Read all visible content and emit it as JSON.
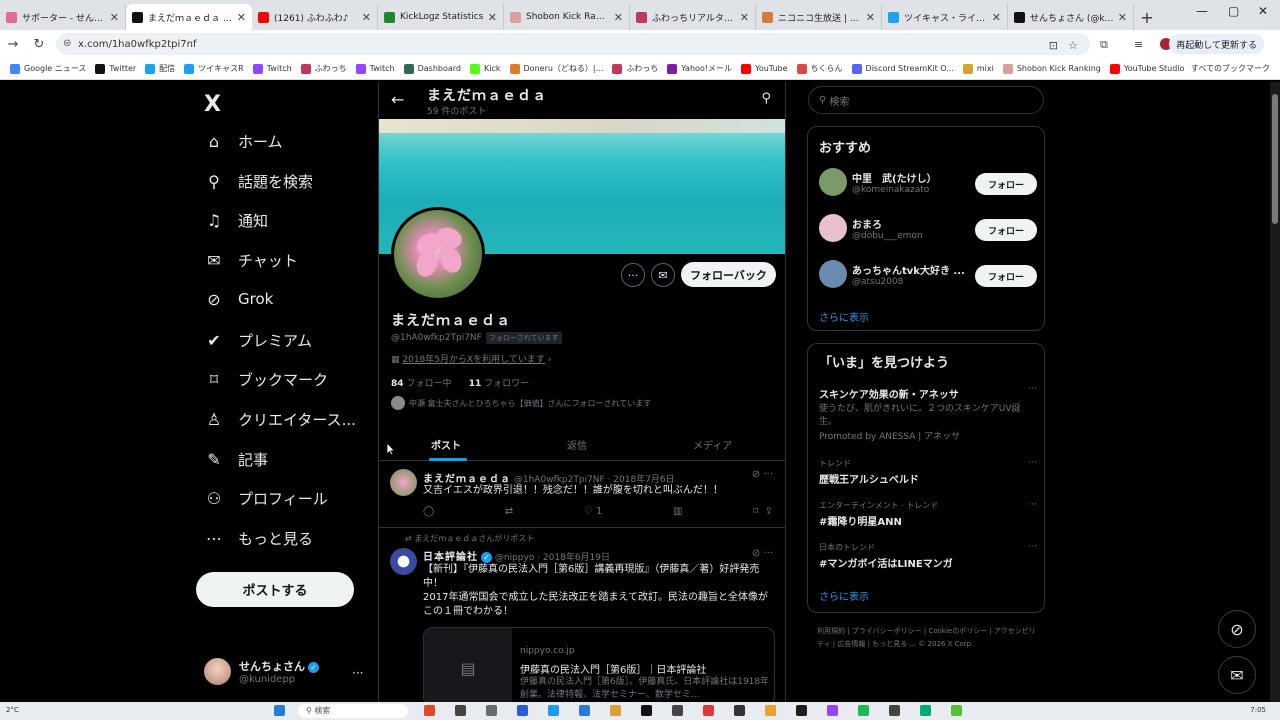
{
  "browser": {
    "tabs": [
      {
        "title": "サポーター - せんちょさん",
        "color": "#e66a8f",
        "active": false
      },
      {
        "title": "まえだｍａｅｄａ (@",
        "color": "#111111",
        "active": true
      },
      {
        "title": "(1261) ふわふわ♪",
        "color": "#ff0000",
        "active": false
      },
      {
        "title": "KickLogz Statistics",
        "color": "#1f8a2b",
        "active": false
      },
      {
        "title": "Shobon Kick Ranking",
        "color": "#d9a0a0",
        "active": false
      },
      {
        "title": "ふわっちリアルタイムランキ",
        "color": "#c0395a",
        "active": false
      },
      {
        "title": "ニコニコ生放送 | リアル",
        "color": "#d97a3a",
        "active": false
      },
      {
        "title": "ツイキャス・ライブでつな",
        "color": "#1da1f2",
        "active": false
      },
      {
        "title": "せんちょさん (@kunid",
        "color": "#111111",
        "active": false
      }
    ],
    "url": "x.com/1ha0wfkp2tpi7nf",
    "restart_label": "再起動して更新する",
    "bookmarks": [
      {
        "label": "Google ニュース",
        "color": "#4285f4"
      },
      {
        "label": "Twitter",
        "color": "#111111"
      },
      {
        "label": "配信",
        "color": "#1da1f2"
      },
      {
        "label": "ツイキャスR",
        "color": "#1da1f2"
      },
      {
        "label": "Twitch",
        "color": "#9146ff"
      },
      {
        "label": "ふわっち",
        "color": "#c0395a"
      },
      {
        "label": "Twitch",
        "color": "#9146ff"
      },
      {
        "label": "Dashboard",
        "color": "#2d6a4f"
      },
      {
        "label": "Kick",
        "color": "#53fc18"
      },
      {
        "label": "Doneru（どねる）|...",
        "color": "#e07a2c"
      },
      {
        "label": "ふわっち",
        "color": "#c0395a"
      },
      {
        "label": "Yahoo!メール",
        "color": "#7b1fa2"
      },
      {
        "label": "YouTube",
        "color": "#ff0000"
      },
      {
        "label": "ちくらん",
        "color": "#d94a4a"
      },
      {
        "label": "Discord StreamKit O...",
        "color": "#5865f2"
      },
      {
        "label": "mixi",
        "color": "#d9a233"
      },
      {
        "label": "Shobon Kick Ranking",
        "color": "#d9a0a0"
      },
      {
        "label": "YouTube Studio",
        "color": "#ff0000"
      }
    ],
    "all_bookmarks": "すべてのブックマーク"
  },
  "sidebar": {
    "logo": "X",
    "items": [
      {
        "label": "ホーム",
        "icon": "home-icon",
        "glyph": "⌂"
      },
      {
        "label": "話題を検索",
        "icon": "search-icon",
        "glyph": "⚲"
      },
      {
        "label": "通知",
        "icon": "bell-icon",
        "glyph": "♫"
      },
      {
        "label": "チャット",
        "icon": "mail-icon",
        "glyph": "✉"
      },
      {
        "label": "Grok",
        "icon": "grok-icon",
        "glyph": "⊘"
      },
      {
        "label": "プレミアム",
        "icon": "verified-icon",
        "glyph": "✔"
      },
      {
        "label": "ブックマーク",
        "icon": "bookmark-icon",
        "glyph": "⌑"
      },
      {
        "label": "クリエイタース...",
        "icon": "creator-icon",
        "glyph": "♙"
      },
      {
        "label": "記事",
        "icon": "article-icon",
        "glyph": "✎"
      },
      {
        "label": "プロフィール",
        "icon": "profile-icon",
        "glyph": "⚇"
      },
      {
        "label": "もっと見る",
        "icon": "more-circle-icon",
        "glyph": "⋯"
      }
    ],
    "post_button": "ポストする",
    "account_name": "せんちょさん",
    "account_handle": "@kunidepp"
  },
  "profile": {
    "top_name": "まえだｍａｅｄａ",
    "post_count": "59 件のポスト",
    "name": "まえだｍａｅｄａ",
    "handle": "@1hA0wfkp2Tpi7NF",
    "follows_you": "フォローされています",
    "joined": "2018年5月からXを利用しています",
    "following_count": "84",
    "following_label": "フォロー中",
    "followers_count": "11",
    "followers_label": "フォロワー",
    "followed_by": "中瀬 富士夫さんとひろちゃら【価値】さんにフォローされています",
    "follow_back": "フォローバック",
    "tabs": [
      "ポスト",
      "返信",
      "メディア"
    ]
  },
  "posts": [
    {
      "author": "まえだｍａｅｄａ",
      "meta": "@1hA0wfkp2Tpi7NF · 2018年7月6日",
      "text": "又吉イエスが政界引退！！残念だ！！誰が腹を切れと叫ぶんだ！！",
      "likes": "1"
    },
    {
      "repost_label": "まえだｍａｅｄａさんがリポスト",
      "author": "日本評論社",
      "meta": "@nippyo · 2018年6月19日",
      "text": "【新刊】『伊藤真の民法入門［第6版］講義再現版』（伊藤真／著）好評発売中！\n2017年通常国会で成立した民法改正を踏まえて改訂。民法の趣旨と全体像がこの１冊でわかる！",
      "card_domain": "nippyo.co.jp",
      "card_title": "伊藤真の民法入門［第6版］｜日本評論社",
      "card_desc": "伊藤真の民法入門［第6版］。伊藤真氏。日本評論社は1918年創業。法律特報、法学セミナー、数学セミ..."
    }
  ],
  "right": {
    "search_placeholder": "検索",
    "recommend_title": "おすすめ",
    "suggestions": [
      {
        "name": "中里　武(たけし）",
        "handle": "@komeinakazato",
        "button": "フォロー",
        "color": "#7a9a6a"
      },
      {
        "name": "おまろ",
        "handle": "@dobu___emon",
        "button": "フォロー",
        "color": "#e8c0d0"
      },
      {
        "name": "あっちゃんtvk大好き ...",
        "handle": "@atsu2008",
        "button": "フォロー",
        "color": "#6a8ab0"
      }
    ],
    "show_more": "さらに表示",
    "trends_title": "「いま」を見つけよう",
    "trends": [
      {
        "category": "",
        "name": "スキンケア効果の新・アネッサ",
        "desc": "使うたび、肌がきれいに。２つのスキンケアUV誕生。",
        "promo": "Promoted by ANESSA | アネッサ"
      },
      {
        "category": "トレンド",
        "name": "歴戦王アルシュベルド",
        "desc": "",
        "promo": ""
      },
      {
        "category": "エンターテインメント · トレンド",
        "name": "#霜降り明星ANN",
        "desc": "",
        "promo": ""
      },
      {
        "category": "日本のトレンド",
        "name": "#マンガボイ活はLINEマンガ",
        "desc": "",
        "promo": ""
      }
    ],
    "trends_more": "さらに表示",
    "footer": "利用規約 | プライバシーポリシー | Cookieのポリシー | アクセシビリティ | 広告情報 | もっと見る ... © 2026 X Corp."
  },
  "taskbar": {
    "weather": "2°C",
    "search": "検索",
    "clock": "7:05"
  }
}
